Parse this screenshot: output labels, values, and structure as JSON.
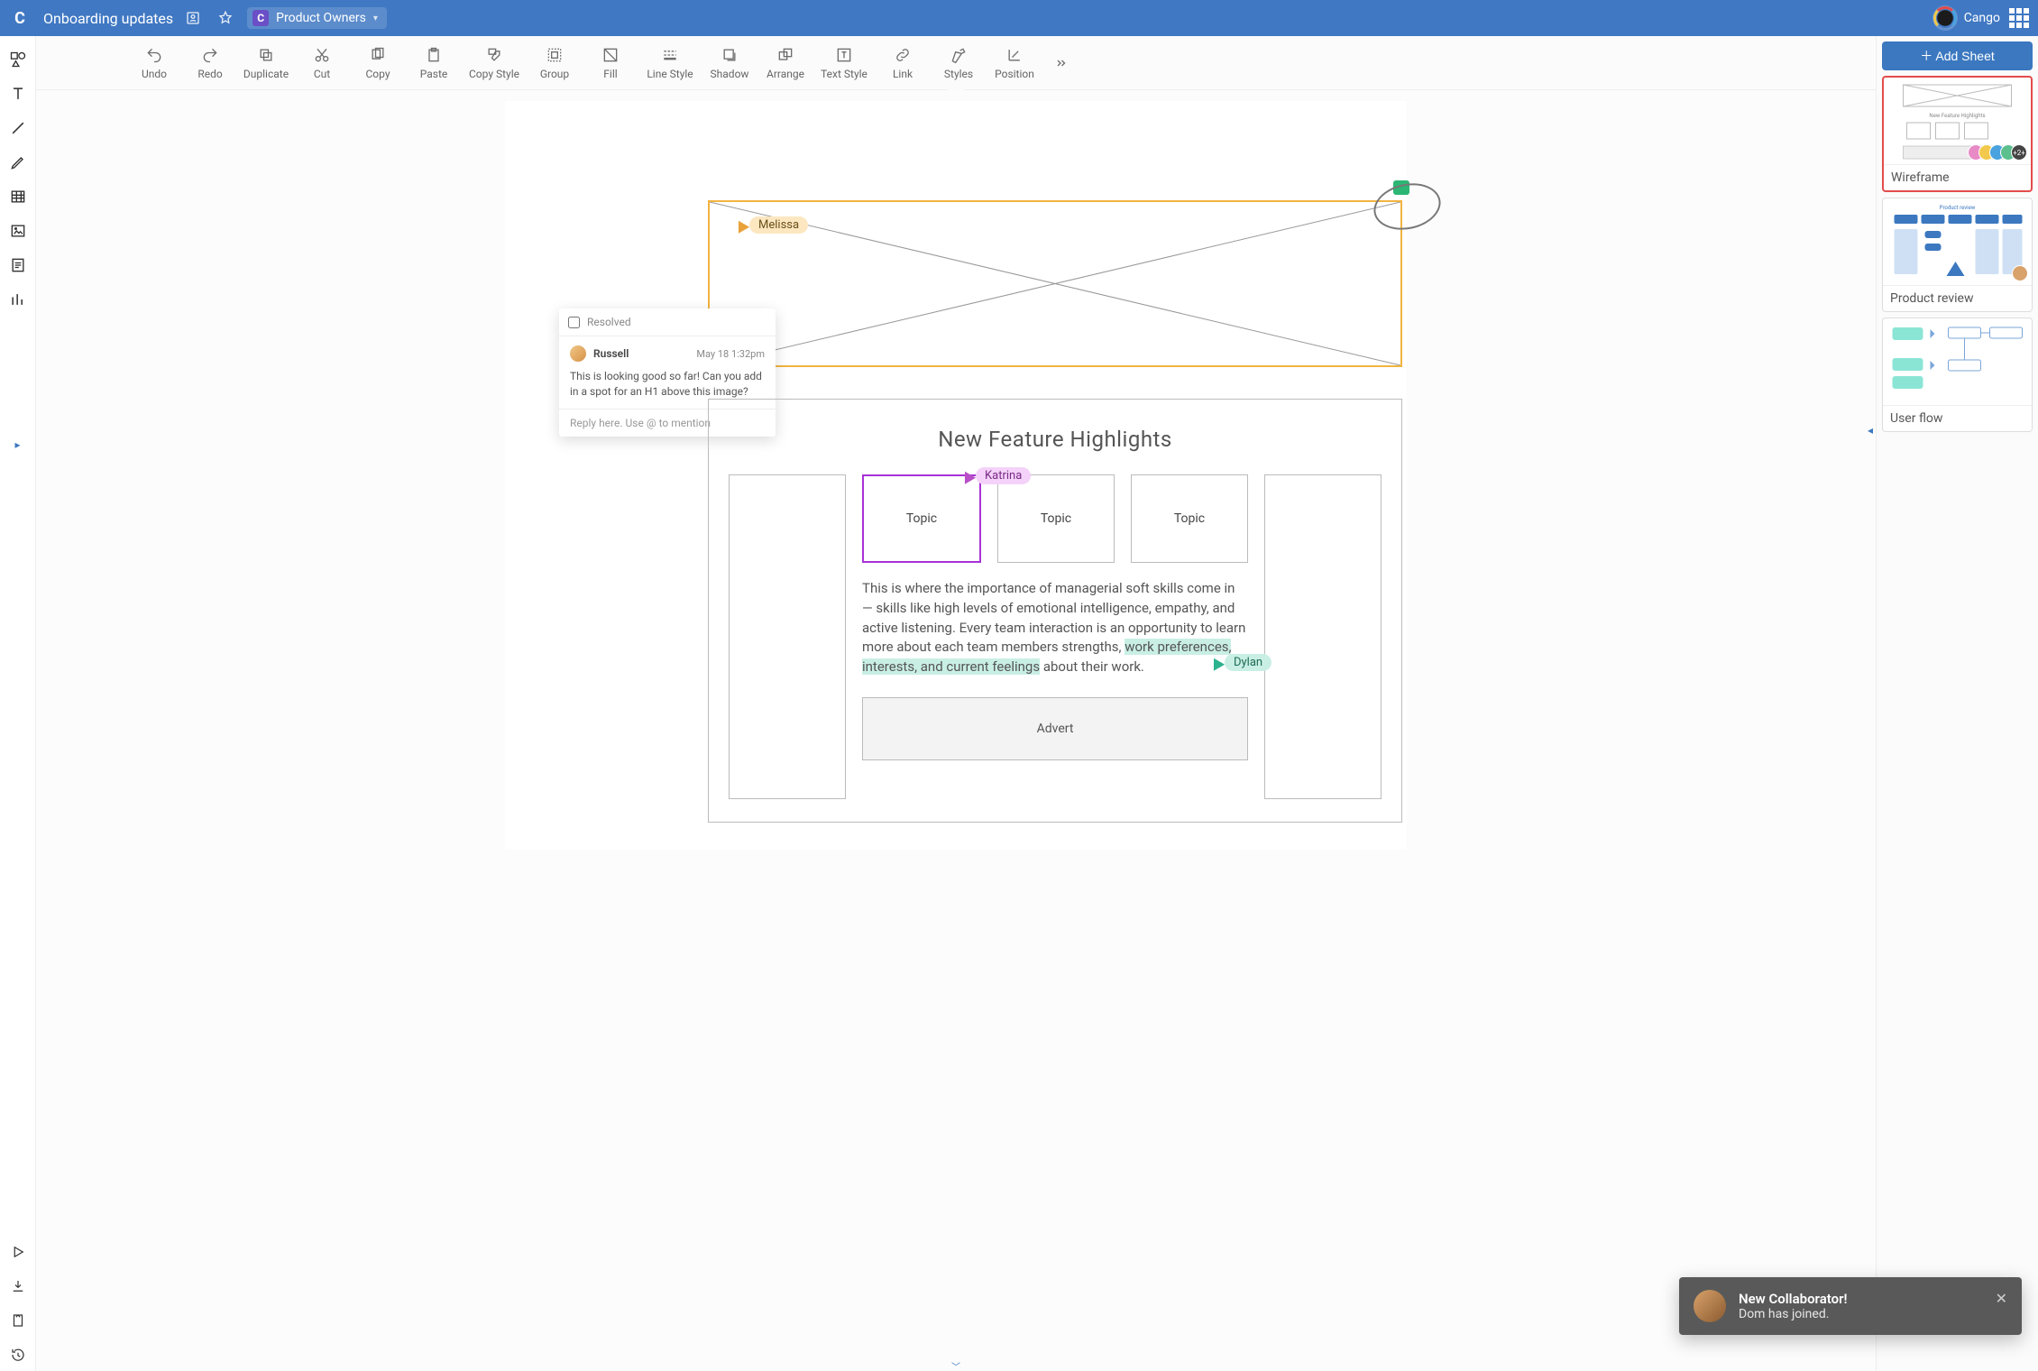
{
  "header": {
    "doc_title": "Onboarding updates",
    "team_label": "Product Owners",
    "brand_name": "Cango"
  },
  "toolbar": {
    "undo": "Undo",
    "redo": "Redo",
    "duplicate": "Duplicate",
    "cut": "Cut",
    "copy": "Copy",
    "paste": "Paste",
    "copy_style": "Copy Style",
    "group": "Group",
    "fill": "Fill",
    "line_style": "Line Style",
    "shadow": "Shadow",
    "arrange": "Arrange",
    "text_style": "Text Style",
    "link": "Link",
    "styles": "Styles",
    "position": "Position"
  },
  "cursors": {
    "melissa": "Melissa",
    "katrina": "Katrina",
    "dylan": "Dylan"
  },
  "wireframe": {
    "heading": "New Feature Highlights",
    "topics": [
      "Topic",
      "Topic",
      "Topic"
    ],
    "body_pre": "This is where the importance of managerial soft skills come in — skills like high levels of emotional intelligence, empathy, and active listening. Every team interaction is an opportunity to learn more about each team members strengths, ",
    "body_hl": "work preferences, interests, and current feelings",
    "body_post": " about their work.",
    "advert": "Advert"
  },
  "comment": {
    "resolved": "Resolved",
    "author": "Russell",
    "time": "May 18 1:32pm",
    "msg": "This is looking good so far! Can you add in a spot for an H1 above this image?",
    "reply_placeholder": "Reply here. Use @ to mention"
  },
  "sheets": {
    "add": "Add Sheet",
    "items": [
      {
        "label": "Wireframe",
        "extra_collaborators": "+2+"
      },
      {
        "label": "Product review"
      },
      {
        "label": "User flow"
      }
    ]
  },
  "toast": {
    "title": "New Collaborator!",
    "subtitle": "Dom has joined."
  }
}
